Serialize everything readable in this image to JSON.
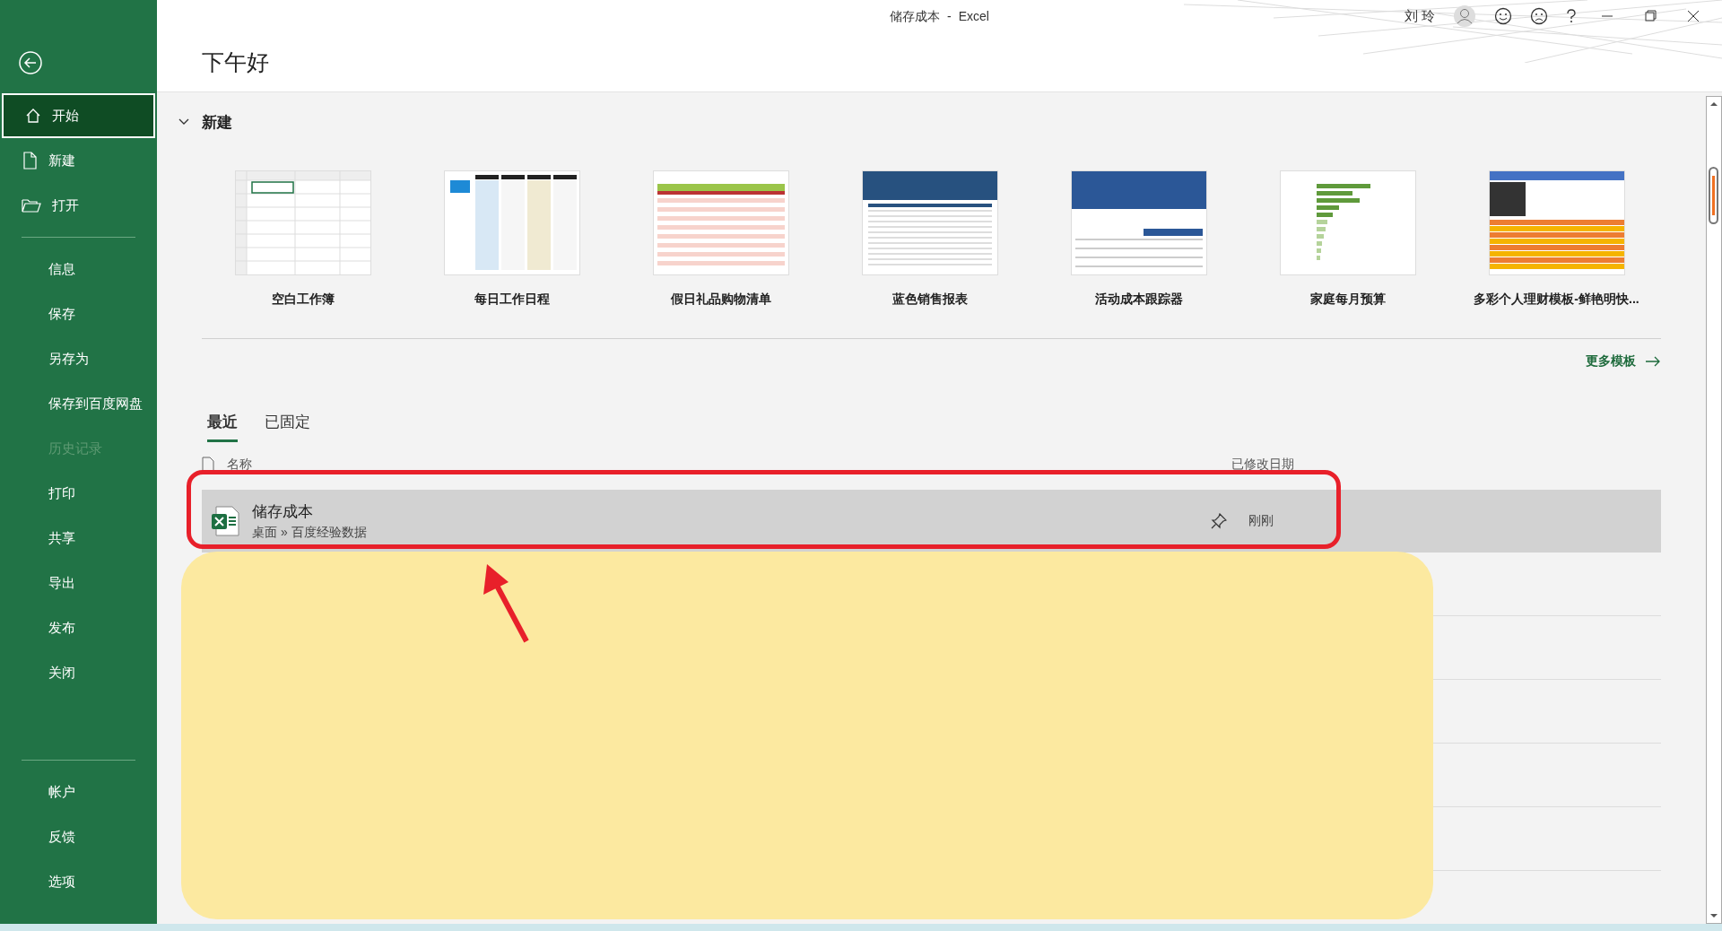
{
  "window": {
    "title": "储存成本",
    "separator": "-",
    "app": "Excel",
    "user": "刘 玲"
  },
  "sidebar": {
    "top_items": [
      {
        "label": "开始",
        "selected": true,
        "disabled": false
      },
      {
        "label": "新建",
        "selected": false,
        "disabled": false
      },
      {
        "label": "打开",
        "selected": false,
        "disabled": false
      }
    ],
    "middle_items": [
      {
        "label": "信息",
        "selected": false,
        "disabled": false
      },
      {
        "label": "保存",
        "selected": false,
        "disabled": false
      },
      {
        "label": "另存为",
        "selected": false,
        "disabled": false
      },
      {
        "label": "保存到百度网盘",
        "selected": false,
        "disabled": false
      },
      {
        "label": "历史记录",
        "selected": false,
        "disabled": true
      },
      {
        "label": "打印",
        "selected": false,
        "disabled": false
      },
      {
        "label": "共享",
        "selected": false,
        "disabled": false
      },
      {
        "label": "导出",
        "selected": false,
        "disabled": false
      },
      {
        "label": "发布",
        "selected": false,
        "disabled": false
      },
      {
        "label": "关闭",
        "selected": false,
        "disabled": false
      }
    ],
    "bottom_items": [
      {
        "label": "帐户",
        "selected": false,
        "disabled": false
      },
      {
        "label": "反馈",
        "selected": false,
        "disabled": false
      },
      {
        "label": "选项",
        "selected": false,
        "disabled": false
      }
    ]
  },
  "greeting": "下午好",
  "new_section": {
    "title": "新建",
    "expanded": true,
    "templates": [
      {
        "label": "空白工作簿"
      },
      {
        "label": "每日工作日程"
      },
      {
        "label": "假日礼品购物清单"
      },
      {
        "label": "蓝色销售报表"
      },
      {
        "label": "活动成本跟踪器"
      },
      {
        "label": "家庭每月预算"
      },
      {
        "label": "多彩个人理财模板-鲜艳明快..."
      }
    ],
    "more_link": "更多模板"
  },
  "recent": {
    "tabs": [
      {
        "label": "最近",
        "selected": true
      },
      {
        "label": "已固定",
        "selected": false
      }
    ],
    "columns": [
      "名称",
      "已修改日期"
    ],
    "rows": [
      {
        "name": "储存成本",
        "path": "桌面 » 百度经验数据",
        "modified": "刚刚",
        "selected": true
      }
    ]
  }
}
